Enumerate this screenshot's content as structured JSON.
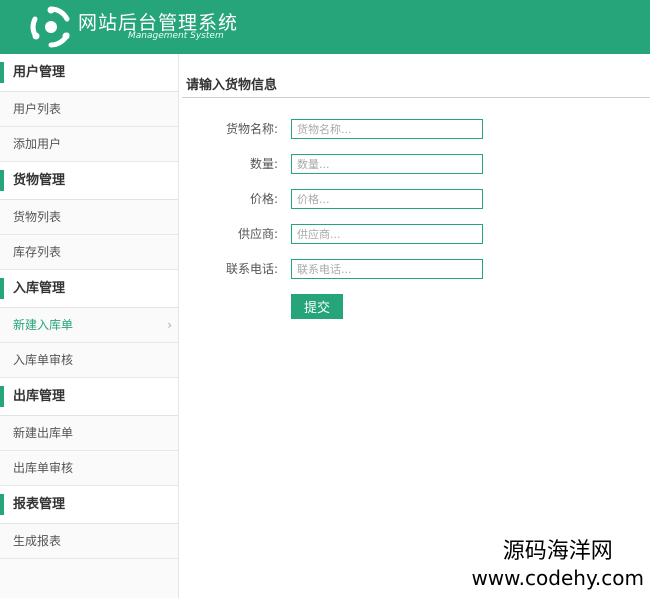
{
  "header": {
    "title": "网站后台管理系统",
    "subtitle": "Management System"
  },
  "sidebar": {
    "groups": [
      {
        "title": "用户管理",
        "items": [
          "用户列表",
          "添加用户"
        ]
      },
      {
        "title": "货物管理",
        "items": [
          "货物列表",
          "库存列表"
        ]
      },
      {
        "title": "入库管理",
        "items": [
          "新建入库单",
          "入库单审核"
        ]
      },
      {
        "title": "出库管理",
        "items": [
          "新建出库单",
          "出库单审核"
        ]
      },
      {
        "title": "报表管理",
        "items": [
          "生成报表"
        ]
      }
    ],
    "active_item": "新建入库单"
  },
  "main": {
    "section_title": "请输入货物信息",
    "fields": [
      {
        "label": "货物名称:",
        "placeholder": "货物名称..."
      },
      {
        "label": "数量:",
        "placeholder": "数量..."
      },
      {
        "label": "价格:",
        "placeholder": "价格..."
      },
      {
        "label": "供应商:",
        "placeholder": "供应商..."
      },
      {
        "label": "联系电话:",
        "placeholder": "联系电话..."
      }
    ],
    "submit_label": "提交"
  },
  "watermark": {
    "name": "源码海洋网",
    "url": "www.codehy.com"
  },
  "colors": {
    "accent": "#27a57a"
  }
}
